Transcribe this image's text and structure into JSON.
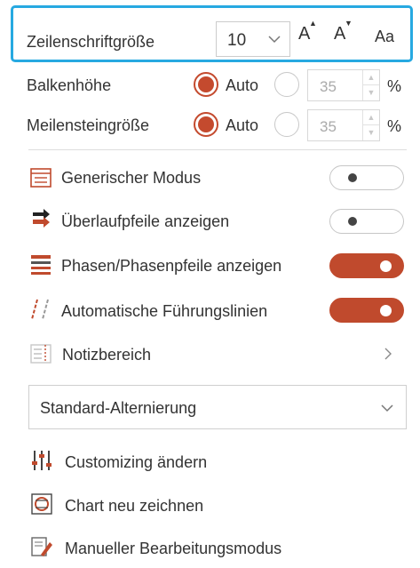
{
  "header_row": {
    "label": "Zeilenschriftgröße",
    "font_size_value": "10",
    "grow_font": "A",
    "shrink_font": "A",
    "change_case": "Aa"
  },
  "bar_height": {
    "label": "Balkenhöhe",
    "auto_label": "Auto",
    "value": "35",
    "unit": "%",
    "auto_selected": true
  },
  "milestone_size": {
    "label": "Meilensteingröße",
    "auto_label": "Auto",
    "value": "35",
    "unit": "%",
    "auto_selected": true
  },
  "toggles": [
    {
      "label": "Generischer Modus",
      "on": false,
      "icon": "generic-mode-icon"
    },
    {
      "label": "Überlaufpfeile anzeigen",
      "on": false,
      "icon": "overflow-arrow-icon"
    },
    {
      "label": "Phasen/Phasenpfeile anzeigen",
      "on": true,
      "icon": "phases-icon"
    },
    {
      "label": "Automatische Führungslinien",
      "on": true,
      "icon": "guide-lines-icon"
    }
  ],
  "notes": {
    "label": "Notizbereich",
    "icon": "notes-area-icon"
  },
  "alternation": {
    "value": "Standard-Alternierung"
  },
  "actions": [
    {
      "label": "Customizing ändern",
      "icon": "customize-icon"
    },
    {
      "label": "Chart neu zeichnen",
      "icon": "redraw-chart-icon"
    },
    {
      "label": "Manueller Bearbeitungsmodus",
      "icon": "manual-edit-icon"
    }
  ],
  "colors": {
    "accent": "#c04a2d",
    "highlight_border": "#27a9e1"
  }
}
